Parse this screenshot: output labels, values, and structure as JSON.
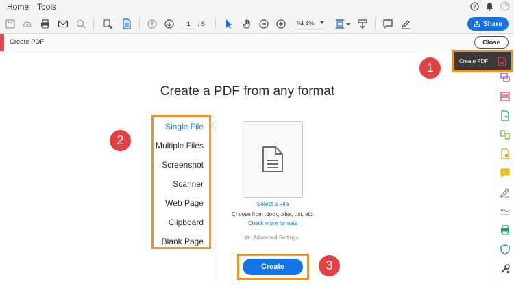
{
  "menubar": {
    "home": "Home",
    "tools": "Tools"
  },
  "toolbar": {
    "page_current": "1",
    "page_total": "/ 5",
    "zoom": "94.4%",
    "share_label": "Share"
  },
  "tool_header": {
    "title": "Create PDF",
    "close_label": "Close"
  },
  "tooltip": {
    "label": "Create PDF"
  },
  "main": {
    "title": "Create a PDF from any format",
    "formats": [
      "Single File",
      "Multiple Files",
      "Screenshot",
      "Scanner",
      "Web Page",
      "Clipboard",
      "Blank Page"
    ],
    "selected_format": "Single File",
    "select_file": "Select a File",
    "choose_from": "Choose from .docx, .xlsx, .txt, etc.",
    "check_more": "Check more formats",
    "advanced": "Advanced Settings",
    "create_label": "Create"
  },
  "badges": [
    "1",
    "2",
    "3"
  ],
  "colors": {
    "accent": "#1473e6",
    "highlight": "#f29222",
    "badge": "#e54040",
    "tool_red": "#e34850"
  },
  "icons": {
    "right_pane": [
      "export-pdf-icon",
      "edit-pdf-icon",
      "organize-pages-icon",
      "combine-files-icon",
      "compress-pdf-icon",
      "protect-icon",
      "comment-icon",
      "fill-sign-icon",
      "request-signature-icon",
      "print-production-icon",
      "shield-icon",
      "more-tools-icon"
    ]
  }
}
